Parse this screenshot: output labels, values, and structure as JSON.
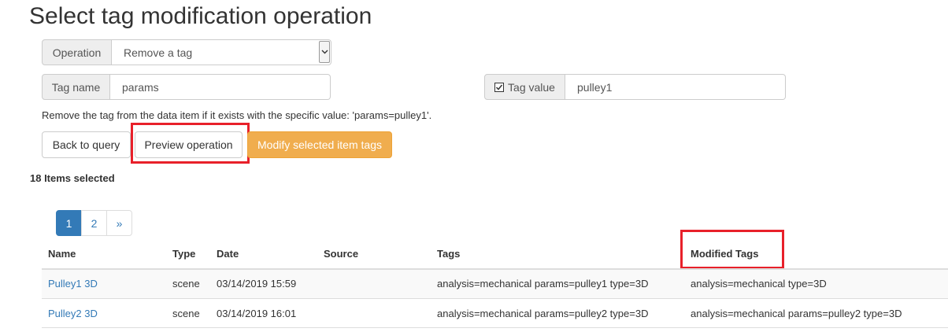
{
  "page": {
    "title": "Select tag modification operation"
  },
  "operation": {
    "label": "Operation",
    "value": "Remove a tag"
  },
  "tag_name": {
    "label": "Tag name",
    "value": "params"
  },
  "tag_value": {
    "checkbox_checked": true,
    "label": "Tag value",
    "value": "pulley1"
  },
  "description": "Remove the tag from the data item if it exists with the specific value: 'params=pulley1'.",
  "buttons": {
    "back": "Back to query",
    "preview": "Preview operation",
    "modify": "Modify selected item tags"
  },
  "selection_count": "18 Items selected",
  "pagination": {
    "pages": [
      "1",
      "2"
    ],
    "next": "»",
    "active": "1"
  },
  "table": {
    "headers": {
      "name": "Name",
      "type": "Type",
      "date": "Date",
      "source": "Source",
      "tags": "Tags",
      "modified": "Modified Tags"
    },
    "rows": [
      {
        "name": "Pulley1 3D",
        "type": "scene",
        "date": "03/14/2019 15:59",
        "source": "",
        "tags": "analysis=mechanical params=pulley1 type=3D",
        "modified": "analysis=mechanical type=3D"
      },
      {
        "name": "Pulley2 3D",
        "type": "scene",
        "date": "03/14/2019 16:01",
        "source": "",
        "tags": "analysis=mechanical params=pulley2 type=3D",
        "modified": "analysis=mechanical params=pulley2 type=3D"
      }
    ]
  },
  "colors": {
    "accent": "#337ab7",
    "warning": "#f0ad4e",
    "highlight": "#e8202a",
    "row_stripe": "#f9f9f9"
  }
}
